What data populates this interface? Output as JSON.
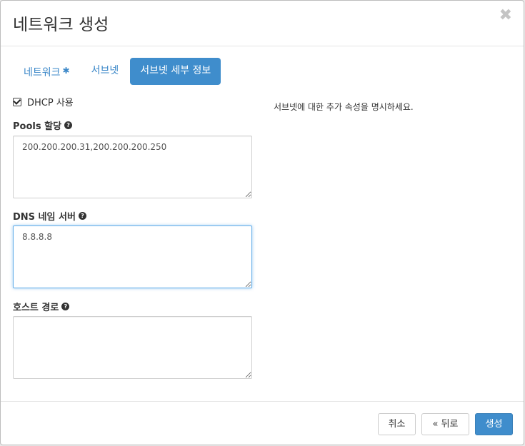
{
  "modal": {
    "title": "네트워크 생성",
    "close_symbol": "✖"
  },
  "tabs": [
    {
      "label": "네트워크",
      "required_marker": "✱"
    },
    {
      "label": "서브넷"
    },
    {
      "label": "서브넷 세부 정보"
    }
  ],
  "form": {
    "dhcp_label": "DHCP 사용",
    "dhcp_checked": true,
    "pools_label": "Pools 할당",
    "pools_value": "200.200.200.31,200.200.200.250",
    "dns_label": "DNS 네임 서버",
    "dns_value": "8.8.8.8",
    "routes_label": "호스트 경로",
    "routes_value": "",
    "help_symbol": "?"
  },
  "help_text": "서브넷에 대한 추가 속성을 명시하세요.",
  "footer": {
    "cancel_label": "취소",
    "back_label": "« 뒤로",
    "create_label": "생성"
  },
  "colors": {
    "primary": "#3f8dcc",
    "link": "#3a87c8",
    "focus_border": "#66afe9"
  }
}
